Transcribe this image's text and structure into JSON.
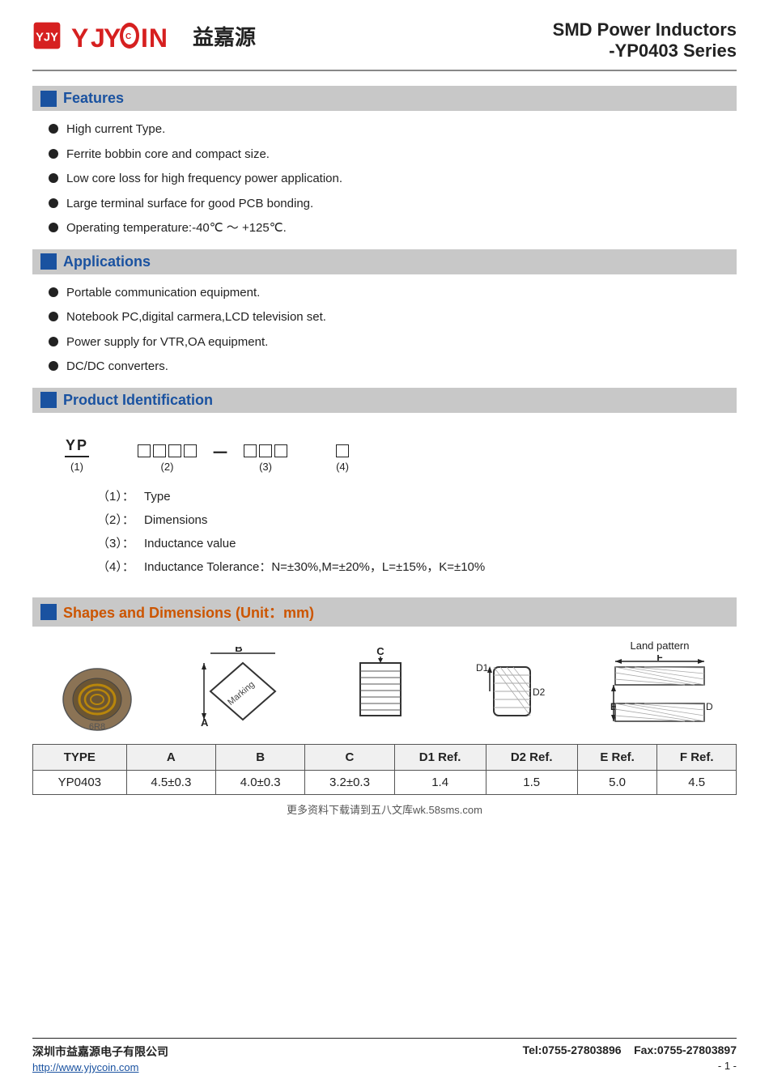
{
  "header": {
    "logo_latin": "YJYCOIN",
    "logo_chinese": "益嘉源",
    "product_line": "SMD Power Inductors",
    "series": "-YP0403 Series"
  },
  "features": {
    "section_title": "Features",
    "items": [
      "High current Type.",
      "Ferrite bobbin core and compact size.",
      "Low core loss for high frequency power application.",
      "Large terminal surface for good PCB bonding.",
      "Operating temperature:-40℃ ～ +125℃."
    ]
  },
  "applications": {
    "section_title": "Applications",
    "items": [
      "Portable communication equipment.",
      "Notebook PC,digital carmera,LCD television set.",
      "Power supply for VTR,OA equipment.",
      "DC/DC converters."
    ]
  },
  "product_id": {
    "section_title": "Product Identification",
    "labels": {
      "yp": "YP",
      "part1_num": "(1)",
      "part2_num": "(2)",
      "part3_num": "(3)",
      "part4_num": "(4)"
    },
    "descriptions": [
      {
        "num": "（1）：",
        "text": "Type"
      },
      {
        "num": "（2）：",
        "text": "Dimensions"
      },
      {
        "num": "（3）：",
        "text": "Inductance value"
      },
      {
        "num": "（4）：",
        "text": "Inductance Tolerance：N=±30%,M=±20%，L=±15%，K=±10%"
      }
    ]
  },
  "shapes": {
    "section_title": "Shapes and Dimensions (Unit：mm)",
    "land_pattern_label": "Land pattern",
    "dim_labels": {
      "B": "B",
      "C": "C",
      "D1": "D1",
      "D2": "D2",
      "E": "E",
      "F": "F",
      "A": "A",
      "marking": "Marking"
    }
  },
  "table": {
    "headers": [
      "TYPE",
      "A",
      "B",
      "C",
      "D1 Ref.",
      "D2 Ref.",
      "E Ref.",
      "F Ref."
    ],
    "rows": [
      [
        "YP0403",
        "4.5±0.3",
        "4.0±0.3",
        "3.2±0.3",
        "1.4",
        "1.5",
        "5.0",
        "4.5"
      ]
    ]
  },
  "footer": {
    "company": "深圳市益嘉源电子有限公司",
    "website": "http://www.yjycoin.com",
    "tel": "Tel:0755-27803896",
    "fax": "Fax:0755-27803897",
    "page": "- 1 -",
    "watermark": "更多资料下载请到五八文库wk.58sms.com"
  }
}
